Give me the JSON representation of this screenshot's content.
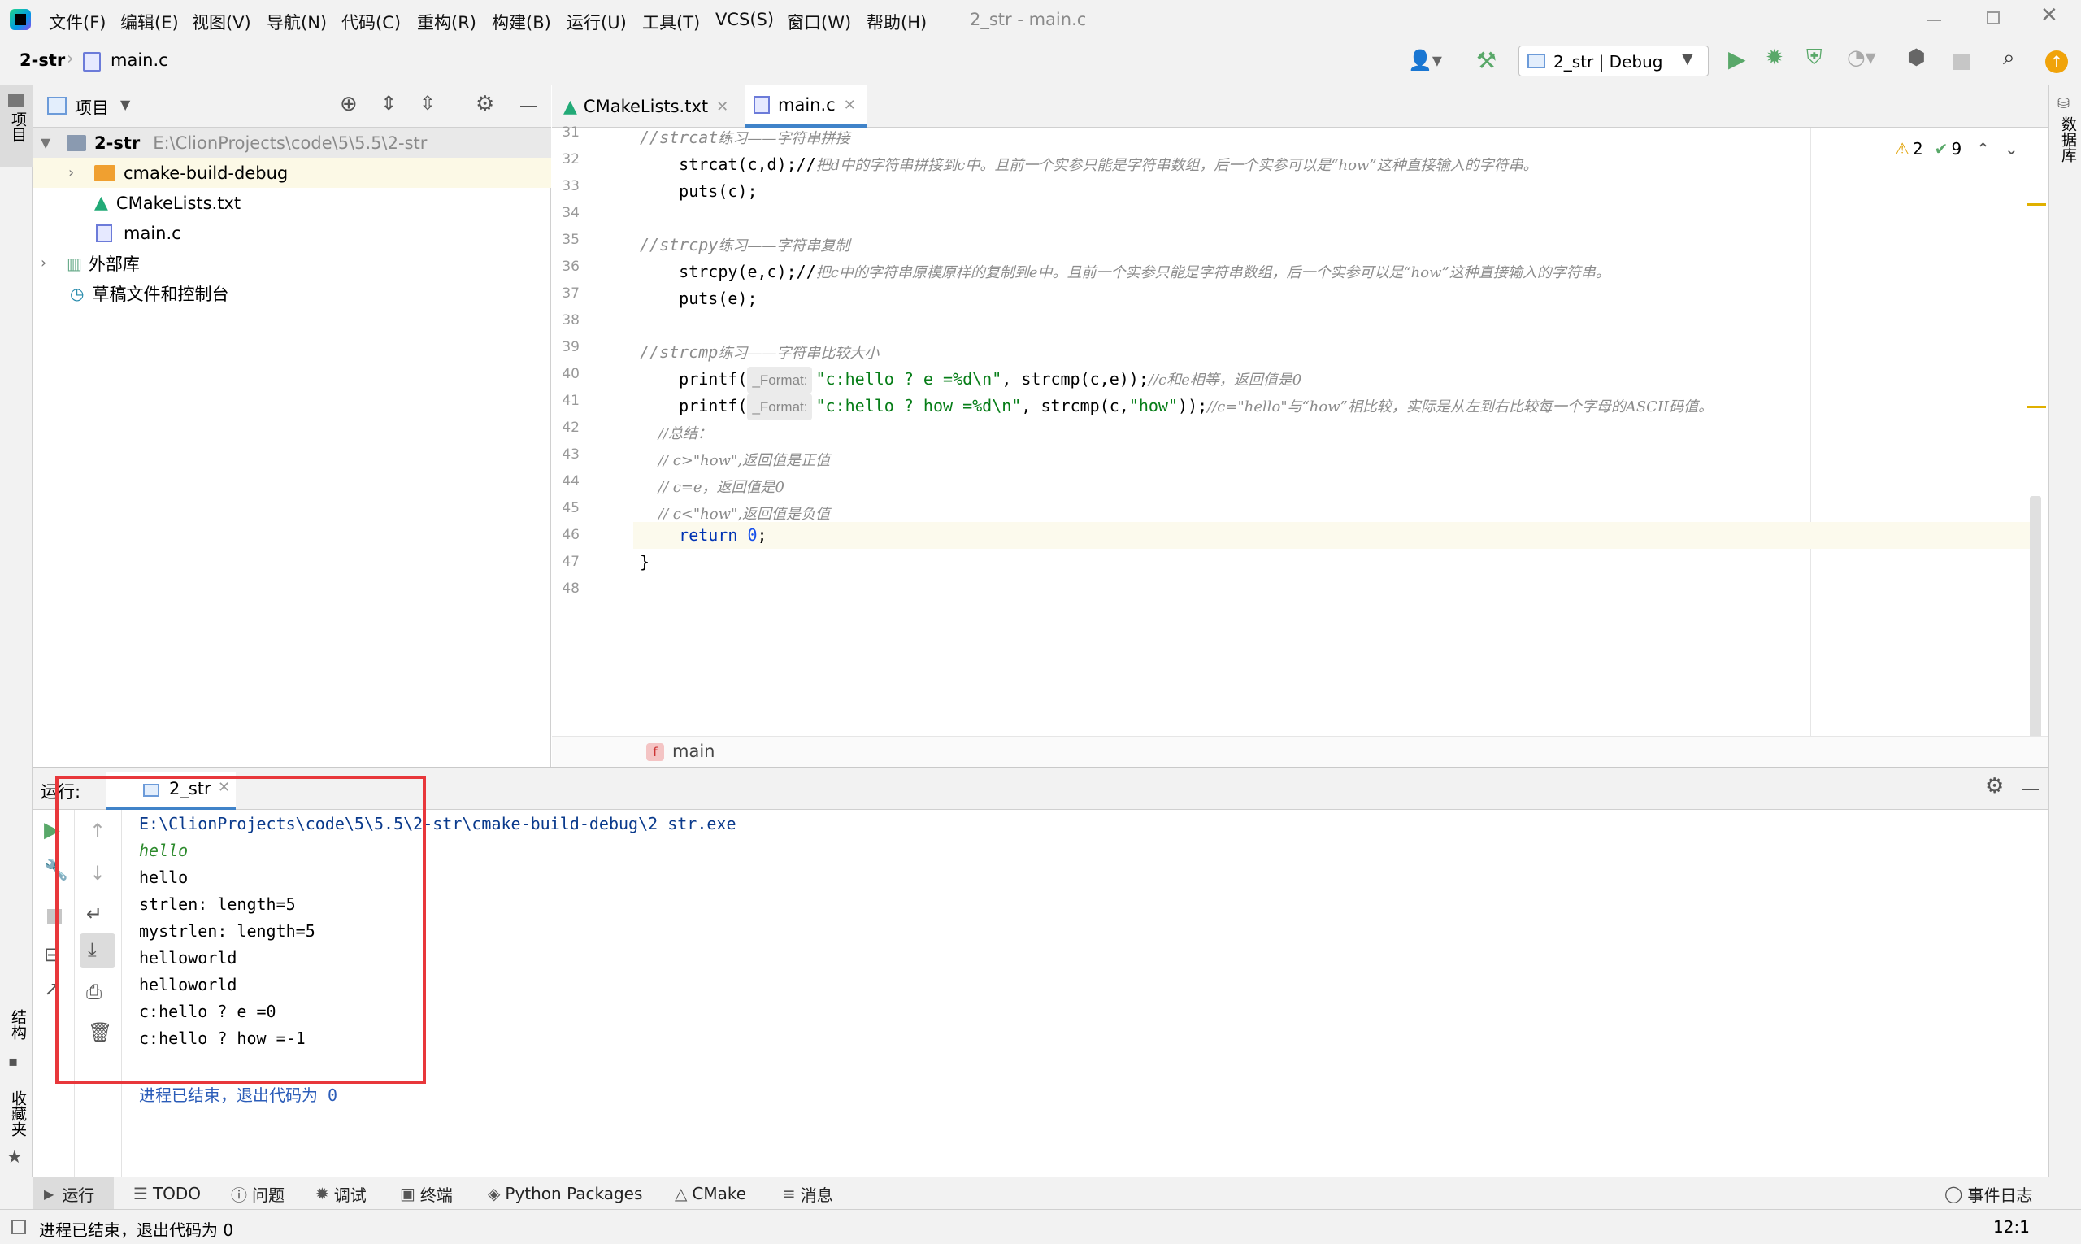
{
  "menubar": {
    "items": [
      "文件(F)",
      "编辑(E)",
      "视图(V)",
      "导航(N)",
      "代码(C)",
      "重构(R)",
      "构建(B)",
      "运行(U)",
      "工具(T)",
      "VCS(S)",
      "窗口(W)",
      "帮助(H)"
    ],
    "window_title": "2_str - main.c"
  },
  "navbar": {
    "project": "2-str",
    "file": "main.c",
    "run_config": "2_str | Debug"
  },
  "side_tools": {
    "left_top": "项目",
    "left_structure": "结构",
    "left_bookmarks": "收藏夹",
    "right_database": "数据库"
  },
  "project_panel": {
    "title": "项目",
    "root_name": "2-str",
    "root_path": "E:\\ClionProjects\\code\\5\\5.5\\2-str",
    "items": [
      "cmake-build-debug",
      "CMakeLists.txt",
      "main.c"
    ],
    "external_libs": "外部库",
    "scratches": "草稿文件和控制台"
  },
  "editor": {
    "tabs": [
      "CMakeLists.txt",
      "main.c"
    ],
    "inspection_warnings": "2",
    "inspection_ok": "9",
    "line_numbers": [
      "31",
      "32",
      "33",
      "34",
      "35",
      "36",
      "37",
      "38",
      "39",
      "40",
      "41",
      "42",
      "43",
      "44",
      "45",
      "46",
      "47",
      "48"
    ],
    "lines": {
      "l31_code": "//strcat",
      "l31_cmt": "练习——字符串拼接",
      "l32_code": "    strcat(c,d);//",
      "l32_cmt": "把d中的字符串拼接到c中。且前一个实参只能是字符串数组，后一个实参可以是“how”这种直接输入的字符串。",
      "l33_code": "    puts(c);",
      "l35_code": "//strcpy",
      "l35_cmt": "练习——字符串复制",
      "l36_code": "    strcpy(e,c);//",
      "l36_cmt": "把c中的字符串原模原样的复制到e中。且前一个实参只能是字符串数组，后一个实参可以是“how”这种直接输入的字符串。",
      "l37_code": "    puts(e);",
      "l39_code": "//strcmp",
      "l39_cmt": "练习——字符串比较大小",
      "l40_a": "    printf(",
      "l40_hint": "_Format:",
      "l40_str": "\"c:hello ? e =%d\\n\"",
      "l40_b": ", strcmp(c,e));",
      "l40_cmt": "//c和e相等，返回值是0",
      "l41_a": "    printf(",
      "l41_hint": "_Format:",
      "l41_str": "\"c:hello ? how =%d\\n\"",
      "l41_b": ", strcmp(c,",
      "l41_str2": "\"how\"",
      "l41_c": "));",
      "l41_cmt": "//c=\"hello\"与“how”相比较，实际是从左到右比较每一个字母的ASCII码值。",
      "l42_cmt": "    //总结：",
      "l43_cmt": "    // c>\"how\",返回值是正值",
      "l44_cmt": "    // c=e，返回值是0",
      "l45_cmt": "    // c<\"how\",返回值是负值",
      "l46_kw": "    return ",
      "l46_num": "0",
      "l46_end": ";",
      "l47_code": "}"
    },
    "breadcrumb_fn": "main"
  },
  "run_panel": {
    "label": "运行:",
    "tab": "2_str",
    "output": [
      "E:\\ClionProjects\\code\\5\\5.5\\2-str\\cmake-build-debug\\2_str.exe",
      "hello",
      "hello",
      "strlen: length=5",
      "mystrlen: length=5",
      "helloworld",
      "helloworld",
      "c:hello ? e =0",
      "c:hello ? how =-1"
    ],
    "exit_message": "进程已结束，退出代码为 0"
  },
  "bottom_tools": [
    "运行",
    "TODO",
    "问题",
    "调试",
    "终端",
    "Python Packages",
    "CMake",
    "消息"
  ],
  "event_log": "事件日志",
  "status": {
    "message": "进程已结束，退出代码为 0",
    "position": "12:1"
  },
  "colors": {
    "highlight_box": "#e8373b",
    "run_green": "#59a869",
    "accent_orange": "#f0a30a"
  }
}
